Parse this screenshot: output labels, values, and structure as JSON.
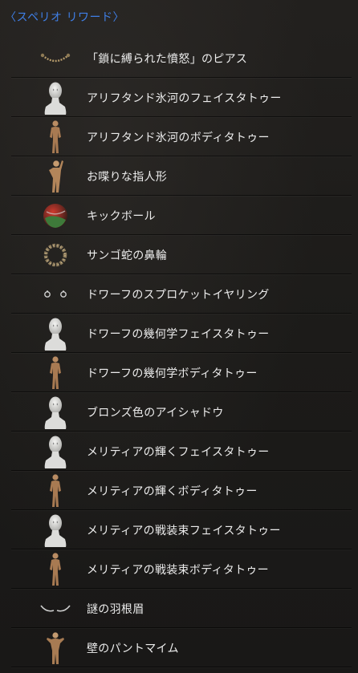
{
  "header": {
    "title": "〈スペリオ リワード〉"
  },
  "items": [
    {
      "label": "「鎖に縛られた憤怒」のピアス",
      "icon": "chain-piercing-icon"
    },
    {
      "label": "アリフタンド氷河のフェイスタトゥー",
      "icon": "face-bust-icon"
    },
    {
      "label": "アリフタンド氷河のボディタトゥー",
      "icon": "body-figure-icon"
    },
    {
      "label": "お喋りな指人形",
      "icon": "finger-puppet-icon"
    },
    {
      "label": "キックボール",
      "icon": "kickball-icon"
    },
    {
      "label": "サンゴ蛇の鼻輪",
      "icon": "nose-ring-icon"
    },
    {
      "label": "ドワーフのスプロケットイヤリング",
      "icon": "earring-icon"
    },
    {
      "label": "ドワーフの幾何学フェイスタトゥー",
      "icon": "face-bust-icon"
    },
    {
      "label": "ドワーフの幾何学ボディタトゥー",
      "icon": "body-figure-icon"
    },
    {
      "label": "ブロンズ色のアイシャドウ",
      "icon": "face-bust-icon"
    },
    {
      "label": "メリティアの輝くフェイスタトゥー",
      "icon": "face-bust-icon"
    },
    {
      "label": "メリティアの輝くボディタトゥー",
      "icon": "body-figure-icon"
    },
    {
      "label": "メリティアの戦装束フェイスタトゥー",
      "icon": "face-bust-icon"
    },
    {
      "label": "メリティアの戦装束ボディタトゥー",
      "icon": "body-figure-icon"
    },
    {
      "label": "謎の羽根眉",
      "icon": "feather-eyebrow-icon"
    },
    {
      "label": "壁のパントマイム",
      "icon": "mime-figure-icon"
    }
  ]
}
